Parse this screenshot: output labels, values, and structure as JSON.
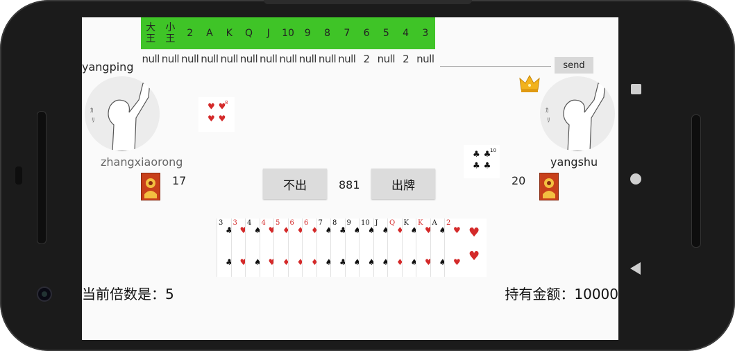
{
  "card_counter": {
    "ranks": [
      {
        "top": "大",
        "bottom": "王"
      },
      {
        "top": "小",
        "bottom": "王"
      },
      {
        "label": "2"
      },
      {
        "label": "A"
      },
      {
        "label": "K"
      },
      {
        "label": "Q"
      },
      {
        "label": "J"
      },
      {
        "label": "10"
      },
      {
        "label": "9"
      },
      {
        "label": "8"
      },
      {
        "label": "7"
      },
      {
        "label": "6"
      },
      {
        "label": "5"
      },
      {
        "label": "4"
      },
      {
        "label": "3"
      }
    ],
    "remaining": [
      "null",
      "null",
      "null",
      "null",
      "null",
      "null",
      "null",
      "null",
      "null",
      "null",
      "null",
      "2",
      "null",
      "2",
      "null"
    ],
    "color": "#3fc427"
  },
  "chat": {
    "input_value": "",
    "send_label": "send"
  },
  "players": {
    "top_left": {
      "name": "yangping"
    },
    "left": {
      "name": "zhangxiaorong",
      "card_count": "17"
    },
    "right": {
      "name": "yangshu",
      "card_count": "20",
      "is_landlord": true
    }
  },
  "played_cards": {
    "left": [
      {
        "rank": "8",
        "suit": "hearts"
      }
    ],
    "right": [
      {
        "rank": "10",
        "suit": "clubs"
      }
    ]
  },
  "actions": {
    "pass_label": "不出",
    "play_label": "出牌",
    "timer": "881"
  },
  "hand": [
    {
      "rank": "3",
      "suit": "clubs"
    },
    {
      "rank": "3",
      "suit": "hearts"
    },
    {
      "rank": "4",
      "suit": "spades"
    },
    {
      "rank": "4",
      "suit": "hearts"
    },
    {
      "rank": "5",
      "suit": "diamonds"
    },
    {
      "rank": "6",
      "suit": "diamonds"
    },
    {
      "rank": "6",
      "suit": "diamonds"
    },
    {
      "rank": "7",
      "suit": "spades"
    },
    {
      "rank": "8",
      "suit": "clubs"
    },
    {
      "rank": "9",
      "suit": "spades"
    },
    {
      "rank": "10",
      "suit": "spades"
    },
    {
      "rank": "J",
      "suit": "spades"
    },
    {
      "rank": "Q",
      "suit": "diamonds"
    },
    {
      "rank": "K",
      "suit": "spades"
    },
    {
      "rank": "K",
      "suit": "hearts"
    },
    {
      "rank": "A",
      "suit": "spades"
    },
    {
      "rank": "2",
      "suit": "hearts"
    }
  ],
  "status": {
    "multiplier_text": "当前倍数是：5",
    "balance_text": "持有金额：10000"
  },
  "colors": {
    "red_suit": "#d42a2a",
    "black_suit": "#111111",
    "card_back": "#c8401a"
  }
}
